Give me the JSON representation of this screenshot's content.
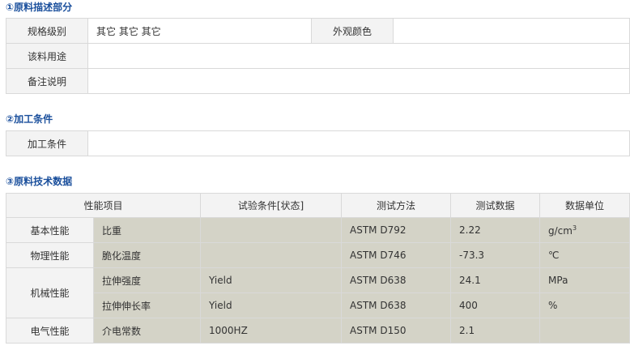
{
  "sections": {
    "raw": "①原料描述部分",
    "process": "②加工条件",
    "tech": "③原料技术数据"
  },
  "raw_table": {
    "spec_label": "规格级别",
    "spec_value": "其它 其它 其它",
    "appearance_label": "外观颜色",
    "appearance_value": "",
    "usage_label": "该料用途",
    "usage_value": "",
    "remark_label": "备注说明",
    "remark_value": ""
  },
  "process_table": {
    "label": "加工条件",
    "value": ""
  },
  "tech_table": {
    "headers": [
      "性能项目",
      "试验条件[状态]",
      "测试方法",
      "测试数据",
      "数据单位"
    ],
    "categories": {
      "basic": "基本性能",
      "physical": "物理性能",
      "mechanical": "机械性能",
      "electrical": "电气性能"
    },
    "rows": [
      {
        "item": "比重",
        "condition": "",
        "method": "ASTM D792",
        "value": "2.22",
        "unit_base": "g/cm",
        "unit_sup": "3"
      },
      {
        "item": "脆化温度",
        "condition": "",
        "method": "ASTM D746",
        "value": "-73.3",
        "unit": "℃"
      },
      {
        "item": "拉伸强度",
        "condition": "Yield",
        "method": "ASTM D638",
        "value": "24.1",
        "unit": "MPa"
      },
      {
        "item": "拉伸伸长率",
        "condition": "Yield",
        "method": "ASTM D638",
        "value": "400",
        "unit": "%"
      },
      {
        "item": "介电常数",
        "condition": "1000HZ",
        "method": "ASTM D150",
        "value": "2.1",
        "unit": ""
      }
    ]
  }
}
